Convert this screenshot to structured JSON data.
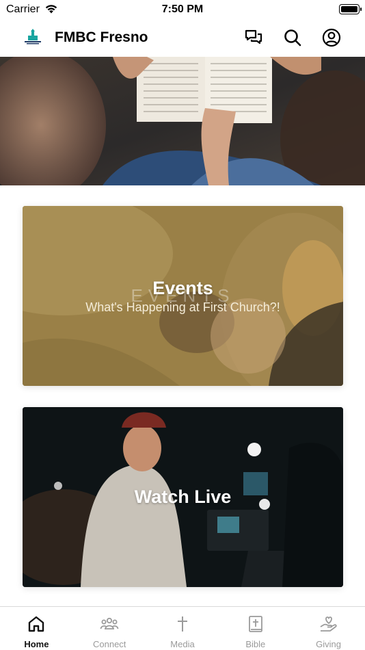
{
  "status_bar": {
    "carrier": "Carrier",
    "time": "7:50 PM"
  },
  "header": {
    "title": "FMBC Fresno",
    "logo_icon": "church-logo-icon",
    "actions": [
      "chat-icon",
      "search-icon",
      "account-icon"
    ]
  },
  "cards": [
    {
      "title": "Events",
      "subtitle": "What's Happening at First Church?!",
      "watermark": "EVENTS"
    },
    {
      "title": "Watch Live"
    }
  ],
  "tabs": [
    {
      "label": "Home",
      "icon": "home-icon",
      "active": true
    },
    {
      "label": "Connect",
      "icon": "people-icon",
      "active": false
    },
    {
      "label": "Media",
      "icon": "cross-icon",
      "active": false
    },
    {
      "label": "Bible",
      "icon": "bible-icon",
      "active": false
    },
    {
      "label": "Giving",
      "icon": "giving-hand-icon",
      "active": false
    }
  ],
  "colors": {
    "active_tab": "#111111",
    "inactive_tab": "#9a9a9a",
    "events_overlay": "#9c8246"
  }
}
